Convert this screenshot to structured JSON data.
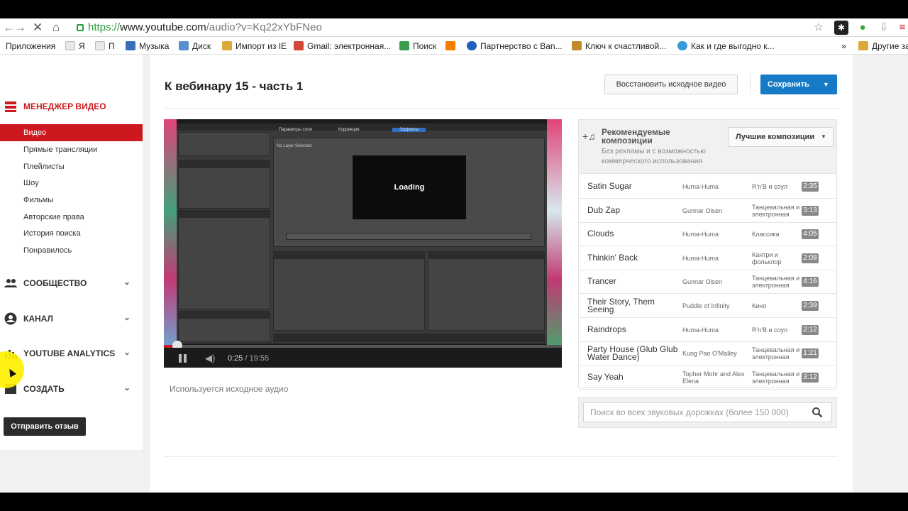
{
  "browser": {
    "url_scheme": "https://",
    "url_host": "www.youtube.com",
    "url_path": "/audio?v=Kq22xYbFNeo",
    "bookmarks": [
      {
        "label": "Приложения",
        "icon": "apps-icon",
        "color": "#4a7bd0"
      },
      {
        "label": "Я",
        "icon": "page-icon",
        "color": "#cccccc"
      },
      {
        "label": "П",
        "icon": "page-icon",
        "color": "#cccccc"
      },
      {
        "label": "Музыка",
        "icon": "music-icon",
        "color": "#3b6dbd"
      },
      {
        "label": "Диск",
        "icon": "disk-icon",
        "color": "#5b8ed1"
      },
      {
        "label": "Импорт из IE",
        "icon": "folder-icon",
        "color": "#d9a93a"
      },
      {
        "label": "Gmail: электронная...",
        "icon": "gmail-icon",
        "color": "#d14836"
      },
      {
        "label": "Поиск",
        "icon": "search-map-icon",
        "color": "#3c9d4a"
      },
      {
        "label": "",
        "icon": "blogger-icon",
        "color": "#f57d00"
      },
      {
        "label": "Партнерство с Ban...",
        "icon": "partner-icon",
        "color": "#1f5fbf"
      },
      {
        "label": "Ключ к счастливой...",
        "icon": "bookmark-icon",
        "color": "#c08a2a"
      },
      {
        "label": "Как и где выгодно к...",
        "icon": "drop-icon",
        "color": "#3a9ad9"
      },
      {
        "label": "»",
        "icon": "more-icon",
        "color": "#ffffff"
      },
      {
        "label": "Другие за",
        "icon": "folder-icon",
        "color": "#d9a93a"
      }
    ]
  },
  "sidebar": {
    "video_manager": "Менеджер видео",
    "items": [
      "Видео",
      "Прямые трансляции",
      "Плейлисты",
      "Шоу",
      "Фильмы",
      "Авторские права",
      "История поиска",
      "Понравилось"
    ],
    "sections": [
      "Сообщество",
      "Канал",
      "YouTube Analytics",
      "Создать"
    ],
    "feedback": "Отправить отзыв"
  },
  "header": {
    "title": "К вебинару 15 - часть 1",
    "restore": "Восстановить исходное видео",
    "save": "Сохранить"
  },
  "video": {
    "time_current": "0:25",
    "time_total": " / 19:55",
    "progress": 0.021,
    "screen_loading": "Loading",
    "screen_tabs": [
      "Параметры слоя",
      "Коррекция",
      "Эффекты"
    ],
    "screen_no_layer": "No Layer Selected"
  },
  "audio_note": "Используется исходное аудио",
  "tracks_panel": {
    "title": "Рекомендуемые композиции",
    "subtitle": "Без рекламы и с возможностью коммерческого использования",
    "sort": "Лучшие композиции",
    "tracks": [
      {
        "title": "Satin Sugar",
        "artist": "Huma-Huma",
        "genre": "R'n'B и соул",
        "duration": "2:35"
      },
      {
        "title": "Dub Zap",
        "artist": "Gunnar Olsen",
        "genre": "Танцевальная и электронная",
        "duration": "3:13"
      },
      {
        "title": "Clouds",
        "artist": "Huma-Huma",
        "genre": "Классика",
        "duration": "4:05"
      },
      {
        "title": "Thinkin' Back",
        "artist": "Huma-Huma",
        "genre": "Кантри и фольклор",
        "duration": "2:08"
      },
      {
        "title": "Trancer",
        "artist": "Gunnar Olsen",
        "genre": "Танцевальная и электронная",
        "duration": "4:16"
      },
      {
        "title": "Their Story, Them Seeing",
        "artist": "Puddle of Infinity",
        "genre": "Кино",
        "duration": "2:39"
      },
      {
        "title": "Raindrops",
        "artist": "Huma-Huma",
        "genre": "R'n'B и соул",
        "duration": "2:12"
      },
      {
        "title": "Party House (Glub Glub Water Dance)",
        "artist": "Kung Pao O'Malley",
        "genre": "Танцевальная и электронная",
        "duration": "1:21"
      },
      {
        "title": "Say Yeah",
        "artist": "Topher Mohr and Alex Elena",
        "genre": "Танцевальная и электронная",
        "duration": "3:12"
      }
    ],
    "search_placeholder": "Поиск во всех звуковых дорожках (более 150 000)"
  },
  "colors": {
    "accent": "#cc181e",
    "primary_button": "#167ac6"
  }
}
